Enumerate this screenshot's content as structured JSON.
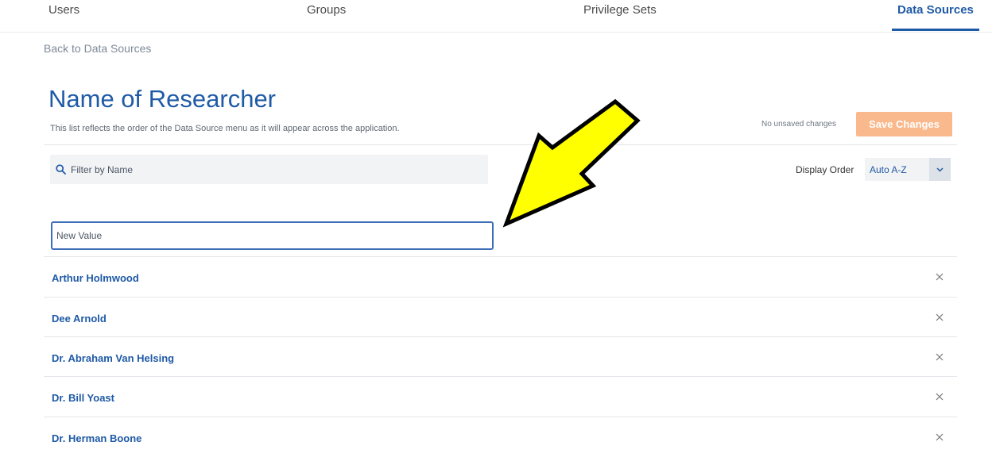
{
  "nav": {
    "tabs": [
      {
        "label": "Users"
      },
      {
        "label": "Groups"
      },
      {
        "label": "Privilege Sets"
      },
      {
        "label": "Data Sources",
        "active": true
      }
    ]
  },
  "back_link": "Back to Data Sources",
  "page": {
    "title": "Name of Researcher",
    "subtitle": "This list reflects the order of the Data Source menu as it will appear across the application.",
    "status": "No unsaved changes",
    "save_label": "Save Changes"
  },
  "filter": {
    "placeholder": "Filter by Name",
    "icon": "search-icon"
  },
  "display_order": {
    "label": "Display Order",
    "value": "Auto A-Z",
    "icon": "chevron-down-icon"
  },
  "new_value": {
    "placeholder": "New Value",
    "value": ""
  },
  "items": [
    {
      "name": "Arthur Holmwood"
    },
    {
      "name": "Dee Arnold"
    },
    {
      "name": "Dr. Abraham Van Helsing"
    },
    {
      "name": "Dr. Bill Yoast"
    },
    {
      "name": "Dr. Herman Boone"
    }
  ],
  "colors": {
    "accent": "#1f5aa6",
    "save_button": "#f9b98c",
    "annotation_arrow": "#ffff00"
  }
}
